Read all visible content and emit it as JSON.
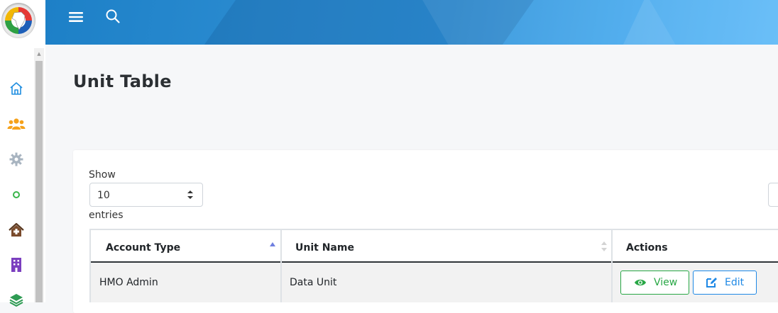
{
  "app": {
    "logo_icon": "africa-globe-logo"
  },
  "header": {
    "menu_icon": "hamburger-icon",
    "search_icon": "search-icon",
    "brand_color": "#2f93d9"
  },
  "sidebar": {
    "items": [
      {
        "icon": "home-icon",
        "color": "#1f8ee0"
      },
      {
        "icon": "users-icon",
        "color": "#f5a11a"
      },
      {
        "icon": "gear-icon",
        "color": "#a8b4c0"
      },
      {
        "icon": "circle-icon",
        "color": "#39b54a"
      },
      {
        "icon": "clinic-icon",
        "color": "#7a4b2c"
      },
      {
        "icon": "building-icon",
        "color": "#7b3fbf"
      },
      {
        "icon": "layers-icon",
        "color": "#2e9b53"
      }
    ]
  },
  "page": {
    "title": "Unit Table"
  },
  "datatable": {
    "show_label": "Show",
    "page_length": "10",
    "entries_label": "entries",
    "columns": [
      "Account Type",
      "Unit Name",
      "Actions"
    ],
    "rows": [
      {
        "account_type": "HMO Admin",
        "unit_name": "Data Unit"
      }
    ],
    "actions": {
      "view_label": "View",
      "edit_label": "Edit",
      "view_color": "#28a745",
      "edit_color": "#1e88e5"
    }
  }
}
